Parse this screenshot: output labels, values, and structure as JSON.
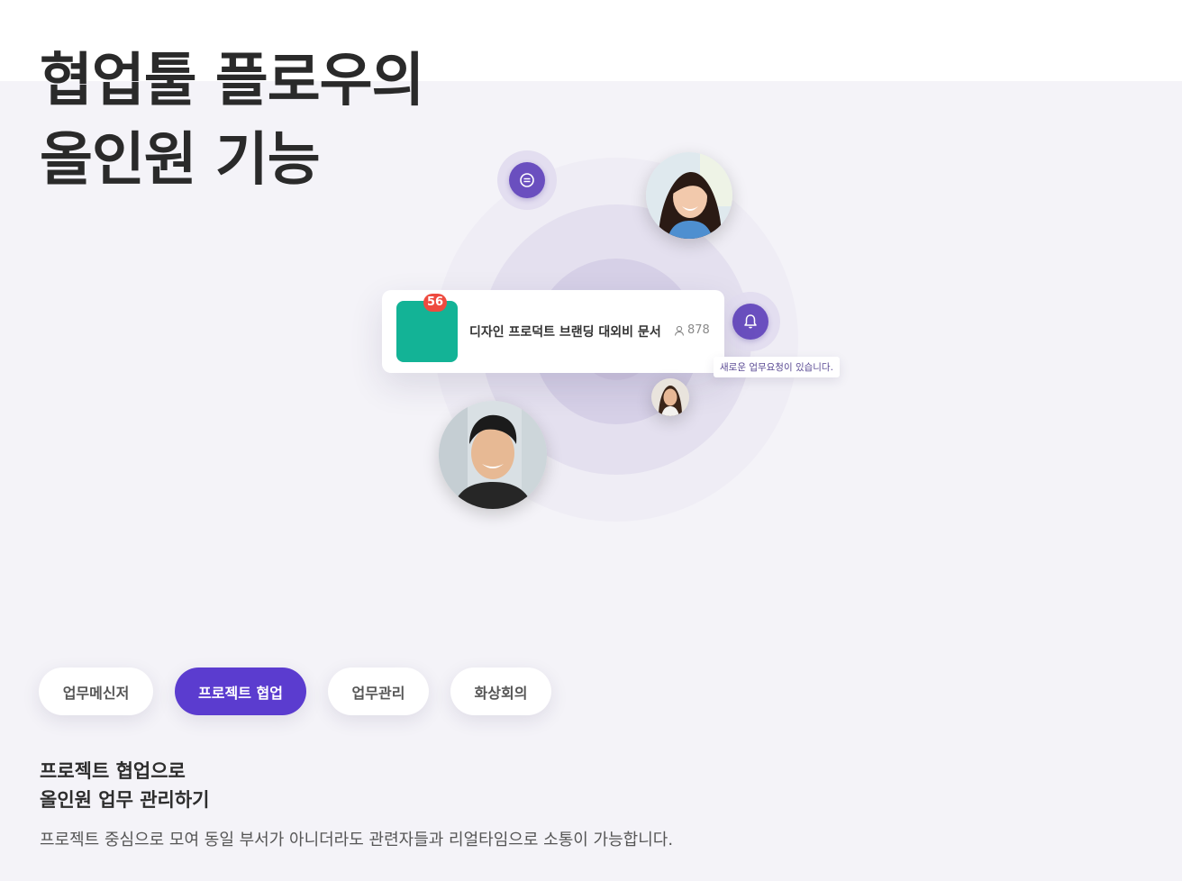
{
  "hero": {
    "title_line1": "협업툴 플로우의",
    "title_line2": "올인원 기능"
  },
  "illustration": {
    "project_card": {
      "badge": "56",
      "name": "디자인 프로덕트 브랜딩 대외비 문서",
      "member_count": "878"
    },
    "notification": "새로운 업무요청이 있습니다.",
    "icons": {
      "chat": "chat-bubble-icon",
      "bell": "bell-icon",
      "members": "person-icon"
    }
  },
  "tabs": [
    {
      "label": "업무메신저",
      "active": false
    },
    {
      "label": "프로젝트 협업",
      "active": true
    },
    {
      "label": "업무관리",
      "active": false
    },
    {
      "label": "화상회의",
      "active": false
    }
  ],
  "section": {
    "heading_line1": "프로젝트 협업으로",
    "heading_line2": "올인원 업무 관리하기",
    "description": "프로젝트 중심으로 모여 동일 부서가 아니더라도 관련자들과 리얼타임으로 소통이 가능합니다."
  },
  "colors": {
    "accent": "#5b3ccf",
    "icon_purple": "#6a4fbf",
    "project_thumb": "#13b396",
    "badge": "#ee4b3f",
    "background": "#f4f3f8"
  }
}
